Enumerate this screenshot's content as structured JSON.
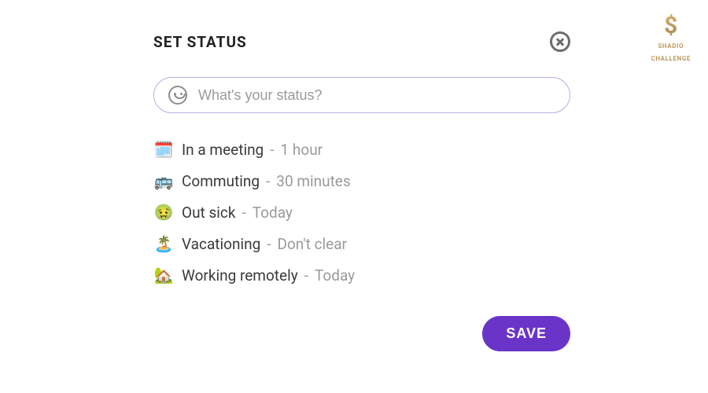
{
  "logo": {
    "symbol": "$",
    "line1": "SHADIO",
    "line2": "CHALLENGE"
  },
  "modal": {
    "title": "SET STATUS",
    "input": {
      "placeholder": "What's your status?",
      "value": ""
    },
    "items": [
      {
        "emoji": "🗓️",
        "label": "In a meeting",
        "duration": "1 hour"
      },
      {
        "emoji": "🚌",
        "label": "Commuting",
        "duration": "30 minutes"
      },
      {
        "emoji": "🤢",
        "label": "Out sick",
        "duration": "Today"
      },
      {
        "emoji": "🏝️",
        "label": "Vacationing",
        "duration": "Don't clear"
      },
      {
        "emoji": "🏡",
        "label": "Working remotely",
        "duration": "Today"
      }
    ],
    "save_label": "SAVE"
  }
}
